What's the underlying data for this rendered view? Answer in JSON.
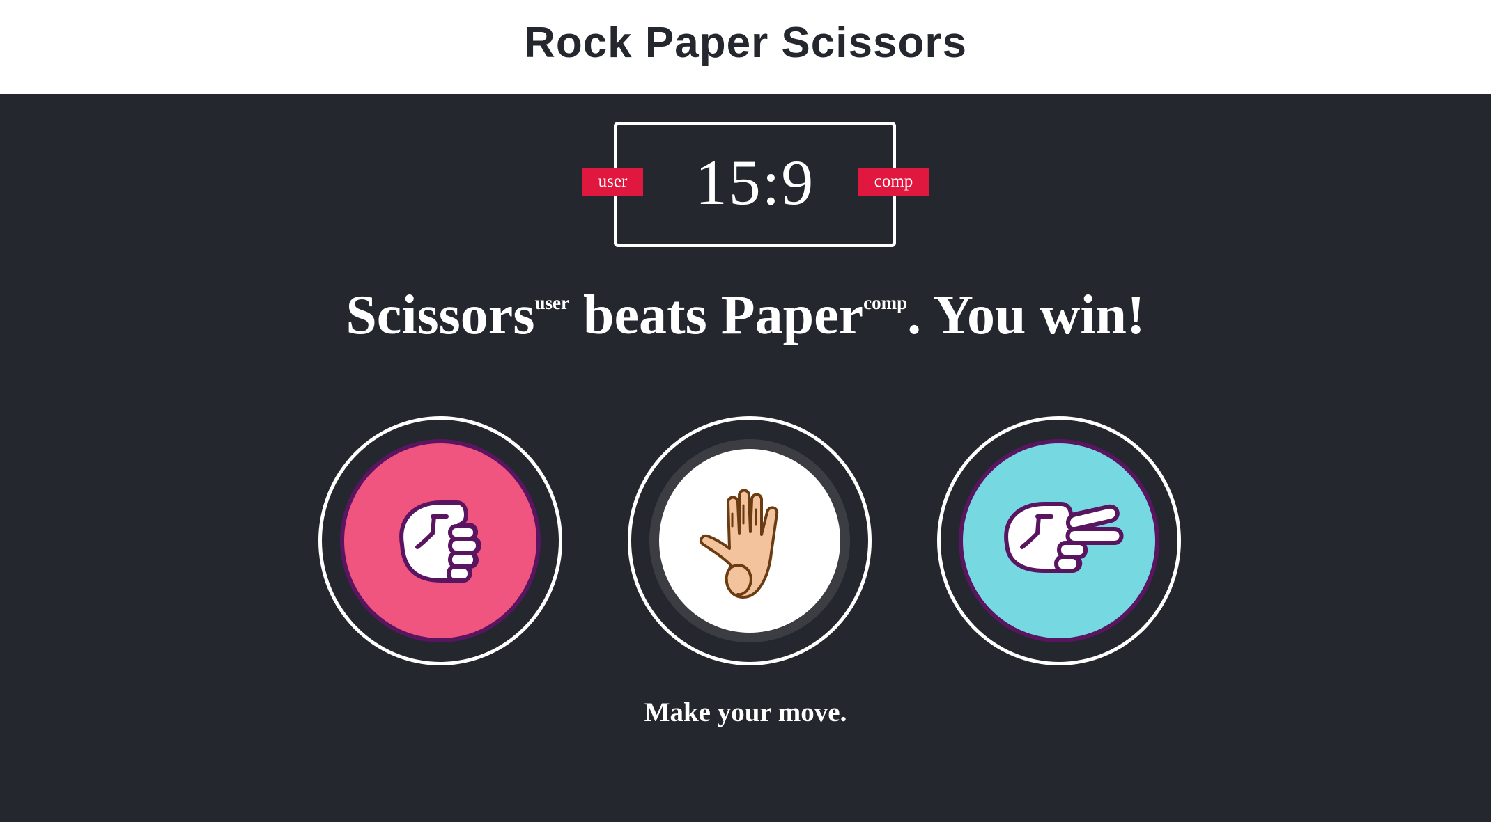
{
  "header": {
    "title": "Rock Paper Scissors"
  },
  "scoreboard": {
    "score": "15:9",
    "user_label": "user",
    "comp_label": "comp"
  },
  "result": {
    "user_choice": "Scissors",
    "user_tag": "user",
    "verb": " beats ",
    "comp_choice": "Paper",
    "comp_tag": "comp",
    "outcome": ". You win!"
  },
  "choices": [
    {
      "id": "rock",
      "icon": "rock-fist-icon",
      "color": "#f0557f"
    },
    {
      "id": "paper",
      "icon": "paper-hand-icon",
      "color": "#ffffff"
    },
    {
      "id": "scissors",
      "icon": "scissors-hand-icon",
      "color": "#76d8e1"
    }
  ],
  "prompt": "Make your move.",
  "colors": {
    "background": "#24272e",
    "header_bg": "#ffffff",
    "badge": "#e0173f",
    "ring_outline": "#5a1560"
  }
}
